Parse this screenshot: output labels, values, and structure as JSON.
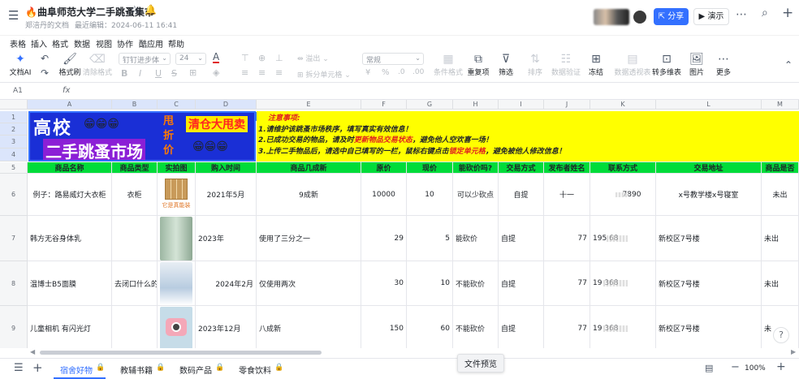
{
  "doc": {
    "title": "🔥曲阜师范大学二手跳蚤集市",
    "author": "郑涪丹的文档",
    "last_edit": "最近编辑：2024-06-11 16:41",
    "share": "分享",
    "present": "演示"
  },
  "menu": [
    "表格",
    "插入",
    "格式",
    "数据",
    "视图",
    "协作",
    "酷应用",
    "帮助"
  ],
  "toolbar": {
    "ai": "文档AI",
    "format_brush": "格式刷",
    "clear_format": "清除格式",
    "font_placeholder": "钉钉进步体",
    "font_size": "24",
    "merge": "溢出",
    "split": "拆分单元格",
    "number_format": "常规",
    "cond_format": "条件格式",
    "dup": "重复项",
    "filter": "筛选",
    "sort": "排序",
    "validate": "数据验证",
    "freeze": "冻结",
    "pivot": "数据透视表",
    "convert": "转多维表",
    "picture": "图片",
    "more": "更多"
  },
  "formula": {
    "cellref": "A1",
    "fx": "fx"
  },
  "columns": [
    "A",
    "B",
    "C",
    "D",
    "E",
    "F",
    "G",
    "H",
    "I",
    "J",
    "K",
    "L",
    "M"
  ],
  "banner": {
    "line1": "高校",
    "line2": "二手跳蚤市场",
    "sale": "清仓大甩卖",
    "vertical": "甩折价",
    "notice_title": "注意事项:",
    "notice1": "1.请维护该跳蚤市场秩序，填写真实有效信息！",
    "notice2a": "2.已成功交易的物品，请及时",
    "notice2b": "更新物品交易状态",
    "notice2c": "，避免他人空欢喜一场！",
    "notice3a": "3.上传二手物品后，请选中自己填写的一栏，鼠标右键点击",
    "notice3b": "锁定单元格",
    "notice3c": "，避免被他人修改信息！"
  },
  "headers": [
    "商品名称",
    "商品类型",
    "实拍图",
    "购入时间",
    "商品几成新",
    "原价",
    "现价",
    "能砍价吗?",
    "交易方式",
    "发布者姓名",
    "联系方式",
    "交易地址",
    "商品是否"
  ],
  "rows": [
    {
      "num": "6",
      "name": "例子：路易威灯大衣柜",
      "type": "衣柜",
      "pic_caption": "它是真能装",
      "time": "2021年5月",
      "cond": "9成新",
      "orig": "10000",
      "now": "10",
      "bargain": "可以少砍点",
      "trade": "自提",
      "publisher": "十一",
      "contact": "7890",
      "addr": "x号教学楼x号寝室",
      "status": "未出"
    },
    {
      "num": "7",
      "name": "韩方无谷身体乳",
      "type": "",
      "pic_caption": "",
      "time": "2023年",
      "cond": "使用了三分之一",
      "orig": "29",
      "now": "5",
      "bargain": "能砍价",
      "trade": "自提",
      "publisher": "77",
      "contact": "195 68",
      "addr": "新校区7号楼",
      "status": "未出"
    },
    {
      "num": "8",
      "name": "温博士B5面膜",
      "type": "去闭口什么的",
      "pic_caption": "",
      "time": "2024年2月",
      "cond": "仅使用两次",
      "orig": "30",
      "now": "10",
      "bargain": "不能砍价",
      "trade": "自提",
      "publisher": "77",
      "contact": "19 368",
      "addr": "新校区7号楼",
      "status": "未出"
    },
    {
      "num": "9",
      "name": "儿童相机 有闪光灯",
      "type": "",
      "pic_caption": "",
      "time": "2023年12月",
      "cond": "八成新",
      "orig": "150",
      "now": "60",
      "bargain": "不能砍价",
      "trade": "自提",
      "publisher": "77",
      "contact": "19 368",
      "addr": "新校区7号楼",
      "status": "未"
    }
  ],
  "row_nums_top": [
    "1",
    "2",
    "3",
    "4",
    "5"
  ],
  "sheets": [
    "宿舍好物",
    "教辅书籍",
    "数码产品",
    "零食饮料"
  ],
  "tooltip": "文件预览",
  "zoom": "100%",
  "colors": {
    "banner_bg": "#1a2fd6",
    "notice_bg": "#ffff00",
    "header_green": "#00dc3a",
    "accent": "#3370ff",
    "red": "#e02020"
  }
}
